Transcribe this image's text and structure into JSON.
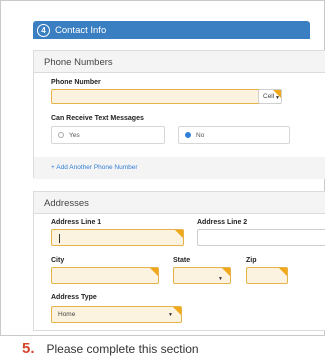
{
  "section": {
    "number": "4",
    "title": "Contact Info"
  },
  "phone": {
    "panel_title": "Phone Numbers",
    "phone_label": "Phone Number",
    "phone_value": "",
    "phone_type": "Cell",
    "text_label": "Can Receive Text Messages",
    "options": [
      {
        "label": "Yes",
        "selected": false
      },
      {
        "label": "No",
        "selected": true
      }
    ],
    "add_link": "+ Add Another Phone Number"
  },
  "address": {
    "panel_title": "Addresses",
    "line1_label": "Address Line 1",
    "line1_value": "",
    "line2_label": "Address Line 2",
    "line2_value": "",
    "city_label": "City",
    "state_label": "State",
    "zip_label": "Zip",
    "type_label": "Address Type",
    "type_value": "Home"
  },
  "instruction": {
    "step": "5.",
    "text": "Please complete this section"
  },
  "colors": {
    "header": "#3a7fc1",
    "required": "#f0a91c",
    "field_fill": "#fbf3df",
    "link": "#2f7fd6",
    "step_number": "#d6452a"
  }
}
